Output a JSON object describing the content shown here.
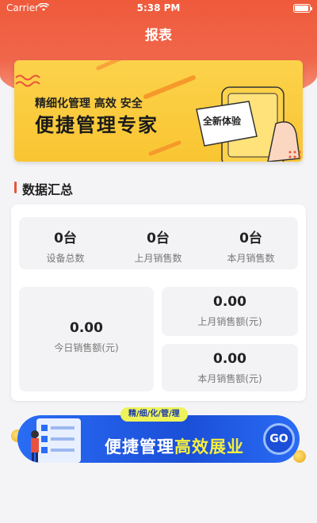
{
  "status_bar": {
    "carrier": "Carrier",
    "time": "5:38 PM"
  },
  "header": {
    "title": "报表"
  },
  "banner": {
    "subtitle": "精细化管理 高效 安全",
    "headline": "便捷管理专家",
    "badge": "全新体验"
  },
  "summary": {
    "section_title": "数据汇总",
    "stats": [
      {
        "value": "0台",
        "label": "设备总数"
      },
      {
        "value": "0台",
        "label": "上月销售数"
      },
      {
        "value": "0台",
        "label": "本月销售数"
      }
    ],
    "today_sales": {
      "value": "0.00",
      "label": "今日销售额(元)"
    },
    "last_month_sales": {
      "value": "0.00",
      "label": "上月销售额(元)"
    },
    "this_month_sales": {
      "value": "0.00",
      "label": "本月销售额(元)"
    }
  },
  "promo": {
    "tag": "精/细/化/管/理",
    "text_white": "便捷管理",
    "text_highlight": "高效展业",
    "go_label": "GO"
  },
  "colors": {
    "accent": "#ef5a3b",
    "banner_yellow": "#fcd24b",
    "promo_blue": "#1b4fd8"
  }
}
